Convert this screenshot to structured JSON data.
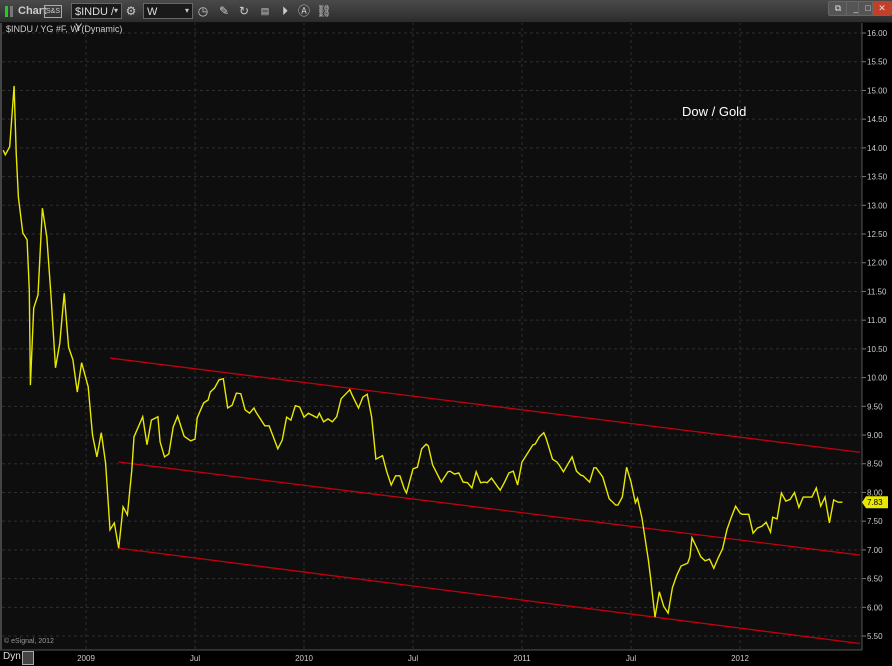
{
  "toolbar": {
    "title": "Chart",
    "symbol": "$INDU / Y",
    "interval": "W",
    "link_badge": "S&S"
  },
  "chart_header": "$INDU / YG #F, W (Dynamic)",
  "annotation": "Dow / Gold",
  "copyright": "© eSignal, 2012",
  "footer": {
    "dyn": "Dyn"
  },
  "colors": {
    "line": "#e8e800",
    "trend": "#c00010",
    "bg": "#0e0e0e"
  },
  "chart_data": {
    "type": "line",
    "title": "$INDU / YG #F, W (Dynamic)",
    "xlabel": "",
    "ylabel": "",
    "ylim": [
      5.5,
      16.0
    ],
    "yticks": [
      "16.00",
      "15.50",
      "15.00",
      "14.50",
      "14.00",
      "13.50",
      "13.00",
      "12.50",
      "12.00",
      "11.50",
      "11.00",
      "10.50",
      "10.00",
      "9.50",
      "9.00",
      "8.50",
      "8.00",
      "7.50",
      "7.00",
      "6.50",
      "6.00",
      "5.50"
    ],
    "xticks": [
      {
        "t": 2009.0,
        "label": "2009"
      },
      {
        "t": 2009.5,
        "label": "Jul"
      },
      {
        "t": 2010.0,
        "label": "2010"
      },
      {
        "t": 2010.5,
        "label": "Jul"
      },
      {
        "t": 2011.0,
        "label": "2011"
      },
      {
        "t": 2011.5,
        "label": "Jul"
      },
      {
        "t": 2012.0,
        "label": "2012"
      }
    ],
    "last_value": "7.83",
    "grid": true,
    "series": [
      {
        "name": "Dow / Gold",
        "points": [
          [
            2008.62,
            13.96
          ],
          [
            2008.63,
            13.88
          ],
          [
            2008.65,
            14.02
          ],
          [
            2008.67,
            15.08
          ],
          [
            2008.68,
            13.91
          ],
          [
            2008.69,
            13.14
          ],
          [
            2008.71,
            12.52
          ],
          [
            2008.73,
            12.4
          ],
          [
            2008.74,
            11.52
          ],
          [
            2008.745,
            9.87
          ],
          [
            2008.76,
            11.21
          ],
          [
            2008.78,
            11.44
          ],
          [
            2008.8,
            12.95
          ],
          [
            2008.82,
            12.45
          ],
          [
            2008.84,
            11.4
          ],
          [
            2008.86,
            10.17
          ],
          [
            2008.88,
            10.6
          ],
          [
            2008.9,
            11.47
          ],
          [
            2008.92,
            10.53
          ],
          [
            2008.94,
            10.31
          ],
          [
            2008.96,
            9.75
          ],
          [
            2008.98,
            10.26
          ],
          [
            2009.01,
            9.84
          ],
          [
            2009.03,
            9.0
          ],
          [
            2009.05,
            8.62
          ],
          [
            2009.07,
            9.04
          ],
          [
            2009.09,
            8.51
          ],
          [
            2009.11,
            7.35
          ],
          [
            2009.13,
            7.47
          ],
          [
            2009.15,
            7.03
          ],
          [
            2009.17,
            7.75
          ],
          [
            2009.19,
            7.61
          ],
          [
            2009.21,
            8.39
          ],
          [
            2009.22,
            8.97
          ],
          [
            2009.26,
            9.32
          ],
          [
            2009.28,
            8.83
          ],
          [
            2009.3,
            9.26
          ],
          [
            2009.33,
            9.32
          ],
          [
            2009.34,
            8.88
          ],
          [
            2009.36,
            8.62
          ],
          [
            2009.38,
            8.67
          ],
          [
            2009.4,
            9.14
          ],
          [
            2009.42,
            9.33
          ],
          [
            2009.45,
            8.98
          ],
          [
            2009.48,
            8.9
          ],
          [
            2009.5,
            8.93
          ],
          [
            2009.51,
            9.3
          ],
          [
            2009.54,
            9.56
          ],
          [
            2009.56,
            9.61
          ],
          [
            2009.57,
            9.75
          ],
          [
            2009.59,
            9.82
          ],
          [
            2009.61,
            9.96
          ],
          [
            2009.63,
            9.98
          ],
          [
            2009.65,
            9.47
          ],
          [
            2009.67,
            9.52
          ],
          [
            2009.69,
            9.73
          ],
          [
            2009.71,
            9.72
          ],
          [
            2009.73,
            9.44
          ],
          [
            2009.75,
            9.38
          ],
          [
            2009.77,
            9.47
          ],
          [
            2009.78,
            9.4
          ],
          [
            2009.82,
            9.16
          ],
          [
            2009.84,
            9.16
          ],
          [
            2009.88,
            8.76
          ],
          [
            2009.9,
            8.91
          ],
          [
            2009.92,
            9.31
          ],
          [
            2009.94,
            9.26
          ],
          [
            2009.96,
            9.51
          ],
          [
            2009.98,
            9.49
          ],
          [
            2010.0,
            9.31
          ],
          [
            2010.02,
            9.38
          ],
          [
            2010.06,
            9.3
          ],
          [
            2010.07,
            9.38
          ],
          [
            2010.09,
            9.23
          ],
          [
            2010.11,
            9.28
          ],
          [
            2010.13,
            9.23
          ],
          [
            2010.15,
            9.32
          ],
          [
            2010.17,
            9.63
          ],
          [
            2010.21,
            9.79
          ],
          [
            2010.22,
            9.7
          ],
          [
            2010.25,
            9.47
          ],
          [
            2010.27,
            9.66
          ],
          [
            2010.29,
            9.71
          ],
          [
            2010.31,
            9.32
          ],
          [
            2010.33,
            8.58
          ],
          [
            2010.36,
            8.64
          ],
          [
            2010.38,
            8.36
          ],
          [
            2010.4,
            8.13
          ],
          [
            2010.42,
            8.29
          ],
          [
            2010.44,
            8.29
          ],
          [
            2010.46,
            8.06
          ],
          [
            2010.47,
            7.99
          ],
          [
            2010.5,
            8.41
          ],
          [
            2010.52,
            8.44
          ],
          [
            2010.54,
            8.76
          ],
          [
            2010.56,
            8.84
          ],
          [
            2010.57,
            8.81
          ],
          [
            2010.59,
            8.48
          ],
          [
            2010.63,
            8.18
          ],
          [
            2010.66,
            8.36
          ],
          [
            2010.67,
            8.37
          ],
          [
            2010.69,
            8.32
          ],
          [
            2010.71,
            8.34
          ],
          [
            2010.73,
            8.18
          ],
          [
            2010.75,
            8.17
          ],
          [
            2010.77,
            8.08
          ],
          [
            2010.79,
            8.36
          ],
          [
            2010.81,
            8.17
          ],
          [
            2010.83,
            8.18
          ],
          [
            2010.84,
            8.17
          ],
          [
            2010.86,
            8.25
          ],
          [
            2010.89,
            8.09
          ],
          [
            2010.9,
            8.04
          ],
          [
            2010.92,
            8.18
          ],
          [
            2010.94,
            8.34
          ],
          [
            2010.96,
            8.37
          ],
          [
            2010.98,
            8.13
          ],
          [
            2011.0,
            8.53
          ],
          [
            2011.02,
            8.65
          ],
          [
            2011.05,
            8.83
          ],
          [
            2011.06,
            8.84
          ],
          [
            2011.08,
            8.97
          ],
          [
            2011.1,
            9.04
          ],
          [
            2011.11,
            8.95
          ],
          [
            2011.14,
            8.58
          ],
          [
            2011.16,
            8.53
          ],
          [
            2011.17,
            8.48
          ],
          [
            2011.19,
            8.36
          ],
          [
            2011.23,
            8.62
          ],
          [
            2011.25,
            8.37
          ],
          [
            2011.27,
            8.3
          ],
          [
            2011.28,
            8.29
          ],
          [
            2011.31,
            8.18
          ],
          [
            2011.33,
            8.43
          ],
          [
            2011.34,
            8.43
          ],
          [
            2011.37,
            8.27
          ],
          [
            2011.4,
            7.89
          ],
          [
            2011.43,
            7.78
          ],
          [
            2011.44,
            7.78
          ],
          [
            2011.46,
            7.92
          ],
          [
            2011.48,
            8.44
          ],
          [
            2011.5,
            8.18
          ],
          [
            2011.52,
            7.82
          ],
          [
            2011.53,
            7.9
          ],
          [
            2011.55,
            7.56
          ],
          [
            2011.58,
            6.82
          ],
          [
            2011.59,
            6.51
          ],
          [
            2011.61,
            5.83
          ],
          [
            2011.63,
            6.27
          ],
          [
            2011.65,
            6.02
          ],
          [
            2011.67,
            5.9
          ],
          [
            2011.69,
            6.34
          ],
          [
            2011.71,
            6.56
          ],
          [
            2011.73,
            6.72
          ],
          [
            2011.76,
            6.77
          ],
          [
            2011.77,
            6.88
          ],
          [
            2011.78,
            7.21
          ],
          [
            2011.8,
            7.05
          ],
          [
            2011.82,
            6.88
          ],
          [
            2011.84,
            6.81
          ],
          [
            2011.86,
            6.84
          ],
          [
            2011.88,
            6.68
          ],
          [
            2011.9,
            6.86
          ],
          [
            2011.92,
            7.02
          ],
          [
            2011.94,
            7.35
          ],
          [
            2011.96,
            7.57
          ],
          [
            2011.98,
            7.76
          ],
          [
            2012.0,
            7.64
          ],
          [
            2012.01,
            7.62
          ],
          [
            2012.04,
            7.62
          ],
          [
            2012.06,
            7.29
          ],
          [
            2012.08,
            7.38
          ],
          [
            2012.1,
            7.41
          ],
          [
            2012.12,
            7.48
          ],
          [
            2012.14,
            7.31
          ],
          [
            2012.15,
            7.57
          ],
          [
            2012.17,
            7.54
          ],
          [
            2012.19,
            7.99
          ],
          [
            2012.21,
            7.85
          ],
          [
            2012.23,
            7.88
          ],
          [
            2012.25,
            8.0
          ],
          [
            2012.27,
            7.74
          ],
          [
            2012.29,
            7.92
          ],
          [
            2012.31,
            7.92
          ],
          [
            2012.33,
            7.92
          ],
          [
            2012.35,
            8.08
          ],
          [
            2012.37,
            7.76
          ],
          [
            2012.39,
            7.92
          ],
          [
            2012.41,
            7.47
          ],
          [
            2012.43,
            7.87
          ],
          [
            2012.45,
            7.83
          ],
          [
            2012.47,
            7.83
          ]
        ]
      }
    ],
    "trendlines": [
      {
        "name": "upper-channel",
        "from": [
          2009.11,
          10.34
        ],
        "to": [
          2012.55,
          8.7
        ]
      },
      {
        "name": "middle-channel",
        "from": [
          2009.15,
          8.53
        ],
        "to": [
          2012.55,
          6.91
        ]
      },
      {
        "name": "lower-channel",
        "from": [
          2009.15,
          7.03
        ],
        "to": [
          2012.55,
          5.37
        ]
      }
    ]
  }
}
